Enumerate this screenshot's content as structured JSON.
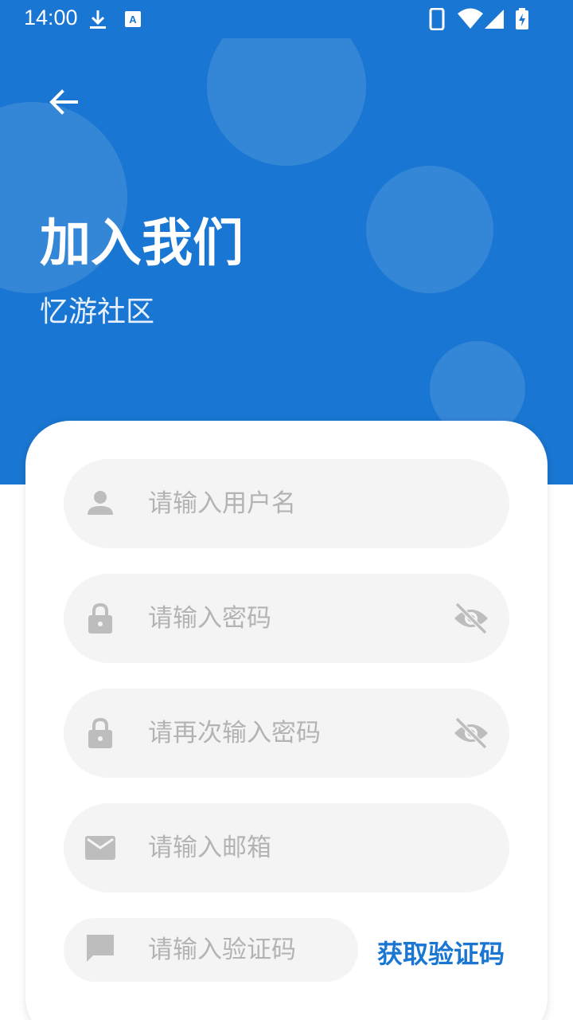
{
  "status_bar": {
    "time": "14:00",
    "icons": [
      "download-icon",
      "keyboard-a-icon",
      "phone-icon",
      "wifi-icon",
      "signal-icon",
      "battery-charging-icon"
    ]
  },
  "header": {
    "title": "加入我们",
    "subtitle": "忆游社区",
    "back_icon": "arrow-left-icon",
    "background_color": "#1976d2"
  },
  "form": {
    "username": {
      "placeholder": "请输入用户名",
      "value": "",
      "icon": "person-icon"
    },
    "password": {
      "placeholder": "请输入密码",
      "value": "",
      "icon": "lock-icon",
      "toggle_icon": "eye-off-icon"
    },
    "confirm_password": {
      "placeholder": "请再次输入密码",
      "value": "",
      "icon": "lock-icon",
      "toggle_icon": "eye-off-icon"
    },
    "email": {
      "placeholder": "请输入邮箱",
      "value": "",
      "icon": "mail-icon"
    },
    "code": {
      "placeholder": "请输入验证码",
      "value": "",
      "icon": "message-icon"
    },
    "get_code_label": "获取验证码"
  },
  "colors": {
    "accent": "#1976d2",
    "field_bg": "#f4f4f4",
    "placeholder": "#b3b3b3",
    "icon_gray": "#bdbdbd"
  }
}
